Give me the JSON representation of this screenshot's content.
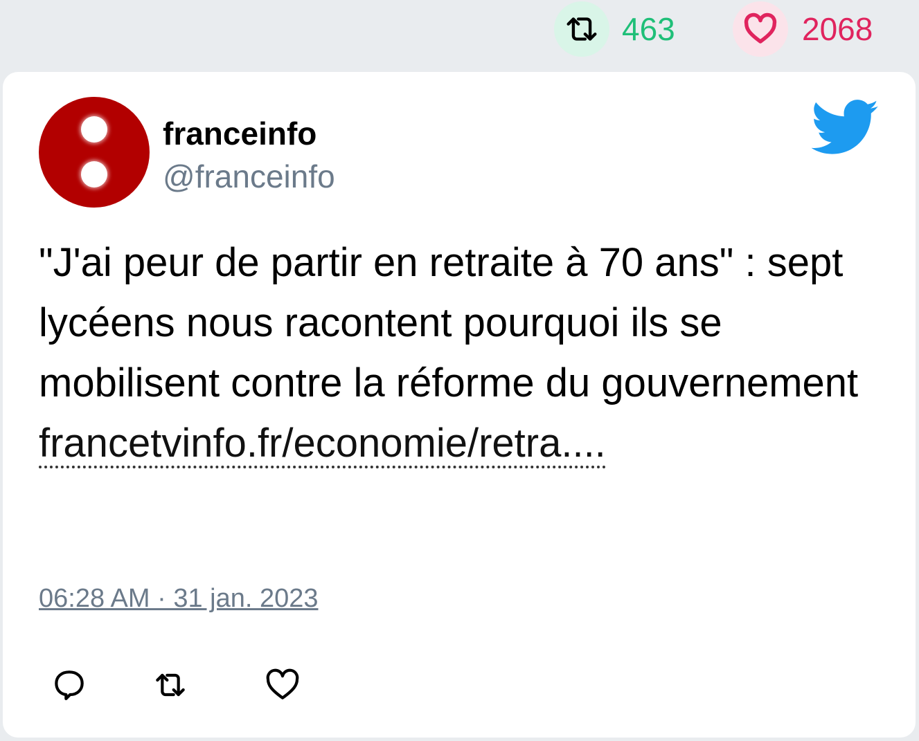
{
  "stats": {
    "retweets": "463",
    "likes": "2068",
    "retweet_color": "#1fbf78",
    "like_color": "#e0245e"
  },
  "tweet": {
    "display_name": "franceinfo",
    "handle": "@franceinfo",
    "text": "\"J'ai peur de partir en retraite à 70 ans\" : sept lycéens nous racontent pourquoi ils se mobilisent contre la réforme du gouvernement",
    "link": "francetvinfo.fr/economie/retra....",
    "timestamp": "06:28 AM · 31 jan. 2023"
  },
  "colors": {
    "twitter_blue": "#1d9bf0",
    "avatar_red": "#b20000"
  },
  "icons": [
    "retweet-icon",
    "heart-icon",
    "twitter-bird-icon",
    "reply-icon"
  ]
}
